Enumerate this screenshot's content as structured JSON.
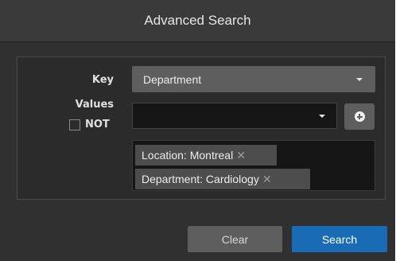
{
  "dialog": {
    "title": "Advanced Search"
  },
  "form": {
    "key_label": "Key",
    "key_value": "Department",
    "values_label": "Values",
    "values_value": "",
    "not_label": "NOT",
    "not_checked": false
  },
  "tags": [
    {
      "label": "Location: Montreal"
    },
    {
      "label": "Department: Cardiology"
    }
  ],
  "buttons": {
    "clear_label": "Clear",
    "search_label": "Search"
  },
  "colors": {
    "accent": "#1a6bb5",
    "dialog_bg": "#303030",
    "control_bg": "#5e5e5e"
  },
  "icons": {
    "add": "plus-circle-icon",
    "tag_remove": "close-icon",
    "dropdown": "caret-down-icon"
  }
}
